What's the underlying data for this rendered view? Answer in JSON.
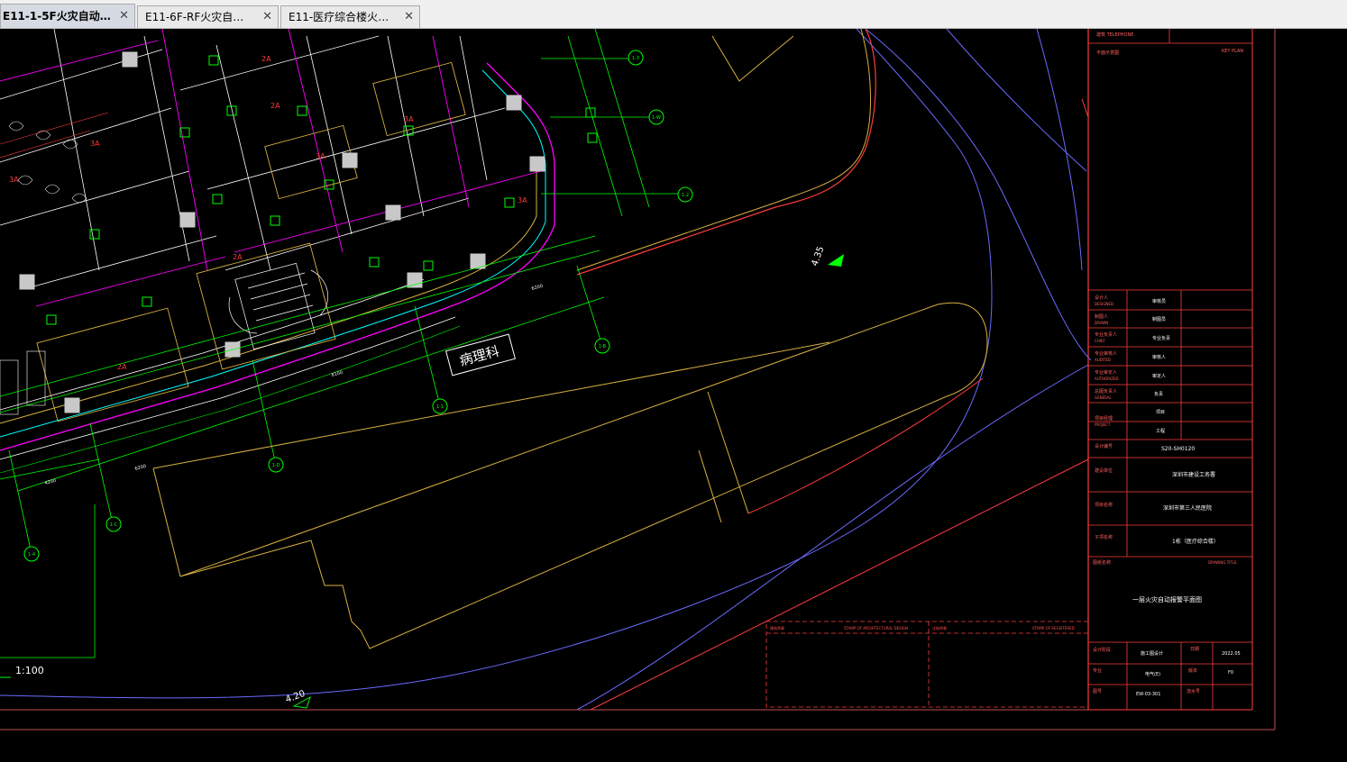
{
  "tabs": [
    {
      "label": "E11-1-5F火灾自动报…",
      "active": true
    },
    {
      "label": "E11-6F-RF火灾自动报…",
      "active": false
    },
    {
      "label": "E11-医疗综合楼火灾…",
      "active": false
    }
  ],
  "icons": {
    "close": "close-icon"
  },
  "colors": {
    "background": "#000000",
    "tab_bar": "#f0f0f0",
    "active_tab": "#d6dbe3",
    "frame_red": "#ff3b3b",
    "wall_yellow": "#d8b040",
    "road_blue": "#6a6aff",
    "grid_green": "#00ff00",
    "magenta": "#ff00ff",
    "cyan": "#00ffff"
  },
  "drawing": {
    "room_label": "病理科",
    "scale_label": "1:100",
    "elevation_1": "4.35",
    "elevation_2": "4.20",
    "grid_axes": [
      "1-3",
      "1-W",
      "1-2",
      "1-B",
      "1-1",
      "1-D",
      "1-C",
      "1-4"
    ],
    "dims": [
      "6200",
      "4200",
      "8100",
      "4100",
      "6200"
    ]
  },
  "title_block": {
    "design_rows": [
      {
        "cn": "设计人",
        "en": "DESIGNED",
        "val": "审核员"
      },
      {
        "cn": "制图人",
        "en": "DRAWN",
        "val": "制图员"
      },
      {
        "cn": "专业负责人",
        "en": "CHIEF",
        "val": "专业负责"
      },
      {
        "cn": "专业审核人",
        "en": "AUDITED",
        "val": "审核人"
      },
      {
        "cn": "专业审定人",
        "en": "AUTHORIZED",
        "val": "审定人"
      },
      {
        "cn": "总图负责人",
        "en": "GENERAL",
        "val": "负责"
      },
      {
        "cn": "项目经理",
        "en": "PROJECT",
        "val": "项目"
      },
      {
        "cn": "",
        "en": "",
        "val": "工程"
      }
    ],
    "design_no_label": "设计编号",
    "design_no": "S20-SH0120",
    "client_label": "建设单位",
    "client": "深圳市建设工务署",
    "project_label": "项目名称",
    "project": "深圳市第三人民医院",
    "subproject_label": "子项名称",
    "subproject": "1栋（医疗综合楼）",
    "drawing_title_label": "图纸名称",
    "drawing_title_en": "DRAWING TITLE.",
    "drawing_title": "一层火灾自动报警平面图",
    "job_stage_label": "设计阶段",
    "job_stage": "施工图设计",
    "date_label": "日期",
    "date": "2022.05",
    "discipline_label": "专业",
    "discipline": "电气(E)",
    "version_label": "版本",
    "version": "F0",
    "drawing_no_label": "图号",
    "drawing_no": "EW-03-301",
    "number_label": "流水号",
    "stamp_label_1": "建筑师章",
    "stamp_label_2": "STAMP OF ARCHITECTURAL DESIGN",
    "stamp_label_3": "注册师章",
    "stamp_label_4": "STAMP OF REGISTERED",
    "key_plan_label": "KEY PLAN",
    "key_plan_cn": "平面示意图",
    "top_label": "建筑 TELEPHONE"
  }
}
